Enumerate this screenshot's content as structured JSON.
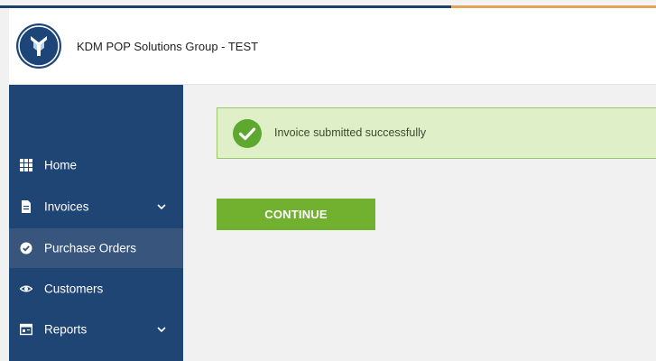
{
  "header": {
    "app_title": "KDM POP Solutions Group - TEST",
    "logo_icon": "kdm-logo-icon"
  },
  "sidebar": {
    "items": [
      {
        "label": "Home",
        "icon": "grid-icon",
        "active": false,
        "expandable": false
      },
      {
        "label": "Invoices",
        "icon": "document-icon",
        "active": false,
        "expandable": true
      },
      {
        "label": "Purchase Orders",
        "icon": "check-circle-icon",
        "active": true,
        "expandable": false
      },
      {
        "label": "Customers",
        "icon": "eye-icon",
        "active": false,
        "expandable": false
      },
      {
        "label": "Reports",
        "icon": "report-icon",
        "active": false,
        "expandable": true
      }
    ]
  },
  "alert": {
    "message": "Invoice submitted successfully",
    "icon": "success-check-icon",
    "type": "success"
  },
  "actions": {
    "continue_label": "CONTINUE"
  },
  "colors": {
    "sidebar_bg": "#1f4574",
    "sidebar_active": "#38557e",
    "accent_green": "#71b12f",
    "alert_bg": "#dff0c8",
    "alert_border": "#9cc56a",
    "top_bar_navy": "#1f3f6e",
    "top_bar_orange": "#e5a25a"
  }
}
